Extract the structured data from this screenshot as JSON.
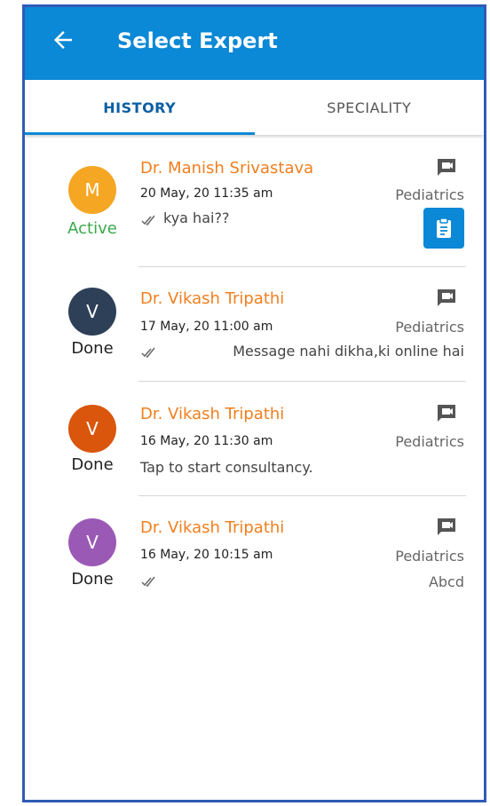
{
  "header": {
    "title": "Select Expert"
  },
  "tabs": [
    {
      "label": "HISTORY",
      "active": true
    },
    {
      "label": "SPECIALITY",
      "active": false
    }
  ],
  "colors": {
    "appbar": "#0b88d6",
    "name": "#f07f1e",
    "active_status": "#3aa84a",
    "avatar_m": "#f5a623",
    "avatar_v_dark": "#2e4058",
    "avatar_v_orange": "#d9560c",
    "avatar_v_purple": "#9b59b6"
  },
  "items": [
    {
      "initial": "M",
      "status": "Active",
      "name": "Dr. Manish Srivastava",
      "date": "20 May, 20 11:35 am",
      "message": "kya hai??",
      "speciality": "Pediatrics",
      "extra": "",
      "icon": "chat-icon"
    },
    {
      "initial": "V",
      "status": "Done",
      "name": "Dr. Vikash Tripathi",
      "date": "17 May, 20 11:00 am",
      "message": "Message nahi dikha,ki online hai",
      "speciality": "Pediatrics",
      "extra": "",
      "icon": "chat-icon"
    },
    {
      "initial": "V",
      "status": "Done",
      "name": "Dr. Vikash Tripathi",
      "date": "16 May, 20 11:30 am",
      "message": "Tap to start consultancy.",
      "speciality": "Pediatrics",
      "extra": "",
      "icon": "chat-icon"
    },
    {
      "initial": "V",
      "status": "Done",
      "name": "Dr. Vikash Tripathi",
      "date": "16 May, 20 10:15 am",
      "message": "",
      "speciality": "Pediatrics",
      "extra": "Abcd",
      "icon": "chat-icon"
    }
  ]
}
